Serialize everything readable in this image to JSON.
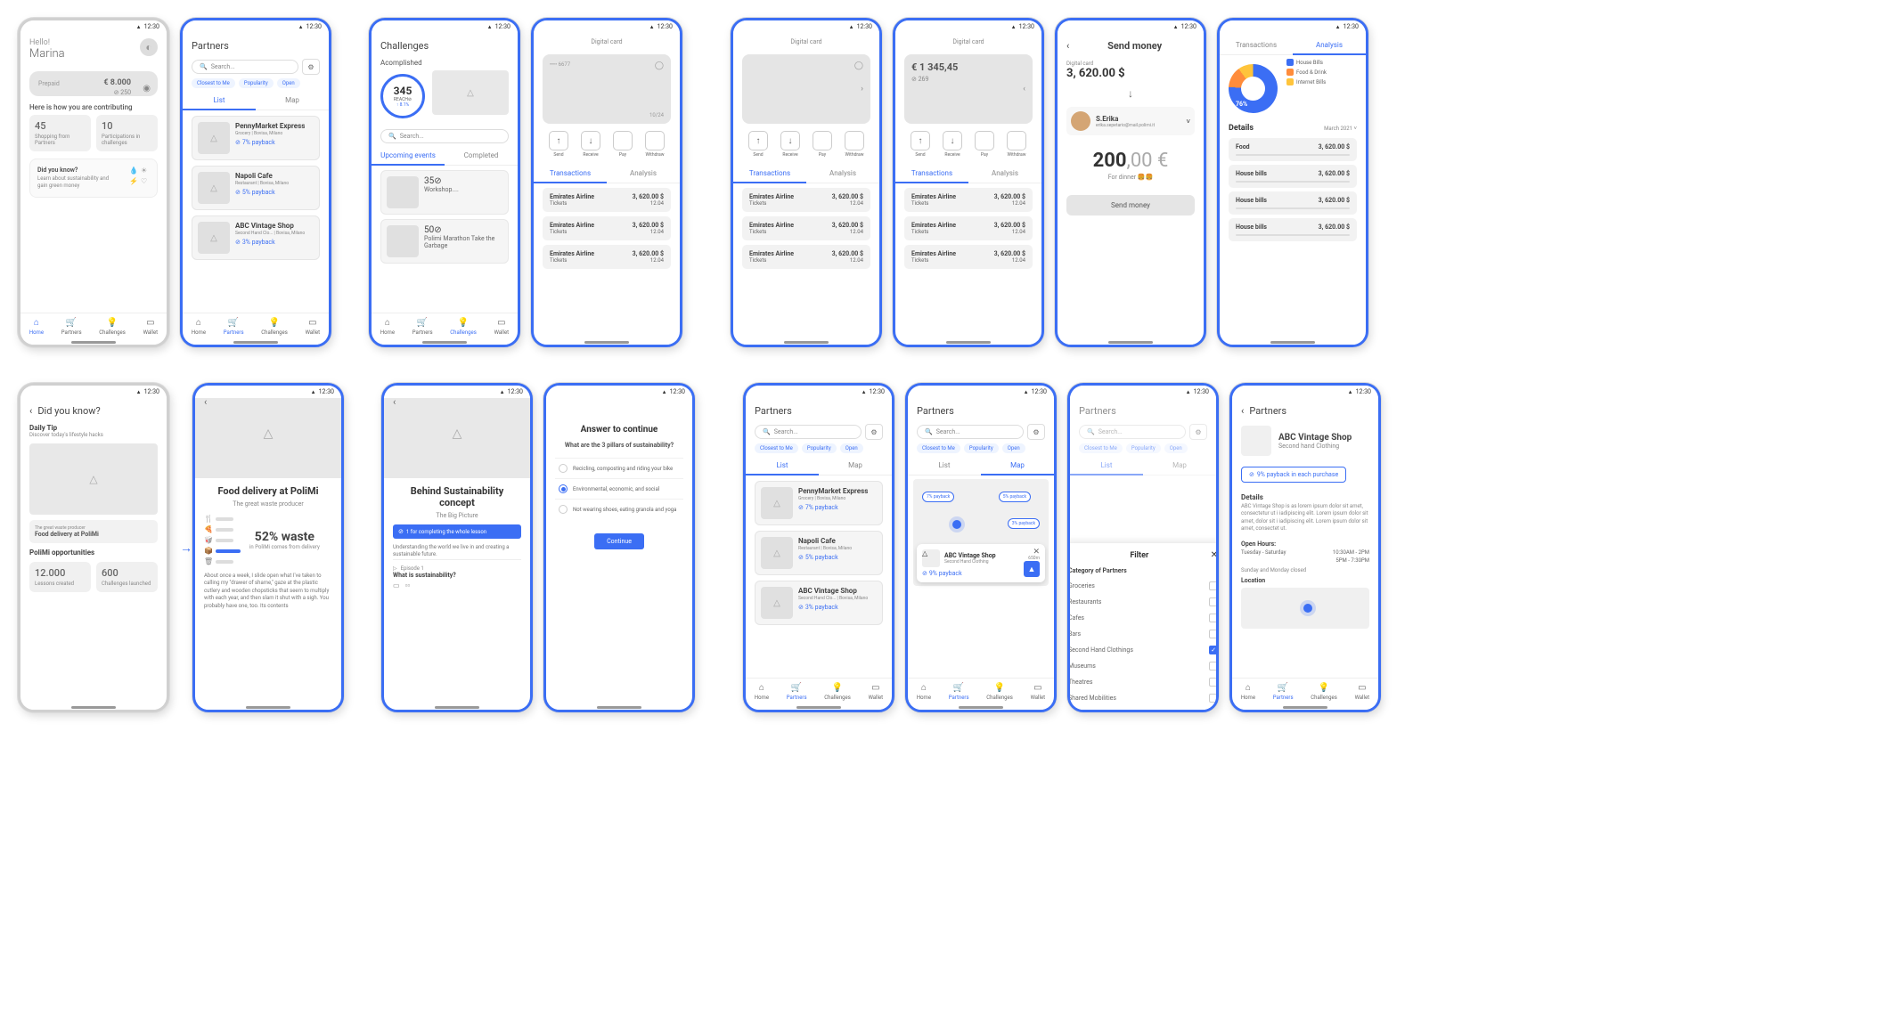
{
  "status_time": "12:30",
  "nav": {
    "home": "Home",
    "partners": "Partners",
    "challenges": "Challenges",
    "wallet": "Wallet"
  },
  "home": {
    "hello": "Hello!",
    "name": "Marina",
    "prepaid": "Prepaid",
    "balance": "€ 8.000",
    "points": "⊘ 250",
    "contribute_title": "Here is how you are contributing",
    "stats": [
      {
        "n": "45",
        "l": "Shopping from Partners"
      },
      {
        "n": "10",
        "l": "Participations in challenges"
      }
    ],
    "dyk_title": "Did you know?",
    "dyk_desc": "Learn about sustainability and gain green money"
  },
  "partners": {
    "title": "Partners",
    "search_ph": "Search...",
    "chips": [
      "Closest to Me",
      "Popularity",
      "Open"
    ],
    "tabs": {
      "list": "List",
      "map": "Map"
    },
    "items": [
      {
        "name": "PennyMarket Express",
        "meta": "Grocery  |  Bovisa, Milano",
        "pb": "7% payback"
      },
      {
        "name": "Napoli Cafe",
        "meta": "Restaurant  |  Bovisa, Milano",
        "pb": "5% payback"
      },
      {
        "name": "ABC Vintage Shop",
        "meta": "Second Hand Clo...  |  Bovisa, Milano",
        "pb": "3% payback"
      }
    ]
  },
  "challenges": {
    "title": "Challenges",
    "acc": "Acomplished",
    "reach": "345",
    "reach_l": "REACH⊘",
    "pct": "↑ 8.1%",
    "search_ph": "Search...",
    "tabs": {
      "up": "Upcoming events",
      "done": "Completed"
    },
    "events": [
      {
        "c": "35⊘",
        "t": "Workshop...."
      },
      {
        "c": "50⊘",
        "t": "Polimi Marathon Take the Garbage"
      }
    ]
  },
  "wallet": {
    "title": "Digital card",
    "card_dots": "•••• 6677",
    "exp": "10/24",
    "amt": "€ 1 345,45",
    "pts": "⊘ 269",
    "actions": [
      "Send",
      "Receive",
      "Pay",
      "Withdraw"
    ],
    "tabs": {
      "tx": "Transactions",
      "an": "Analysis"
    },
    "tx": [
      {
        "n": "Emirates Airline",
        "c": "Tickets",
        "a": "3, 620.00 $",
        "t": "12.04"
      },
      {
        "n": "Emirates Airline",
        "c": "Tickets",
        "a": "3, 620.00 $",
        "t": "12.04"
      },
      {
        "n": "Emirates Airline",
        "c": "Tickets",
        "a": "3, 620.00 $",
        "t": "12.04"
      }
    ]
  },
  "send": {
    "title": "Send money",
    "card_l": "Digital card",
    "card_amt": "3, 620.00 $",
    "pname": "S.Erika",
    "pemail": "erika.sepetario@mail.polimi.it",
    "amount": "200",
    ",cents": ",00 €",
    "note": "For dinner 🍔🍔",
    "btn": "Send money"
  },
  "analysis": {
    "tabs": {
      "tx": "Transactions",
      "an": "Analysis"
    },
    "pie_pct": "76%",
    "legend": [
      {
        "c": "#3b6ef4",
        "l": "House Bills"
      },
      {
        "c": "#ff8c3b",
        "l": "Food & Drink"
      },
      {
        "c": "#ffc43b",
        "l": "Internet Bills"
      }
    ],
    "details": "Details",
    "month": "March 2021 ˅",
    "rows": [
      {
        "l": "Food",
        "a": "3, 620.00 $"
      },
      {
        "l": "House bills",
        "a": "3, 620.00 $"
      },
      {
        "l": "House bills",
        "a": "3, 620.00 $"
      },
      {
        "l": "House bills",
        "a": "3, 620.00 $"
      }
    ]
  },
  "dyk": {
    "title": "Did you know?",
    "tip_t": "Daily Tip",
    "tip_d": "Discover today's lifestyle hacks",
    "card_sub": "The great waste producer",
    "card_t": "Food delivery at PoliMi",
    "opp_t": "PoliMi opportunities",
    "opp": [
      {
        "n": "12.000",
        "l": "Lessons created"
      },
      {
        "n": "600",
        "l": "Challenges launched"
      }
    ]
  },
  "article": {
    "title": "Food delivery at PoliMi",
    "sub": "The great waste producer",
    "waste": "52% waste",
    "waste_sub": "in PoliMi comes from delivery",
    "body": "About once a week, I slide open what I've taken to calling my \"drawer of shame,\" gaze at the plastic cutlery and wooden chopsticks that seem to multiply with each year, and then slam it shut with a sigh. You probably have one, too. Its contents"
  },
  "lesson": {
    "title": "Behind Sustainability concept",
    "sub": "The Big Picture",
    "badge": "1 for completing the whole lesson",
    "desc": "Understanding the world we live in and creating a sustainable future.",
    "ep_l": "Episode 1",
    "ep_t": "What is sustainability?"
  },
  "quiz": {
    "title": "Answer to continue",
    "q": "What are the 3 pillars of sustainability?",
    "opts": [
      "Recicling, composting and riding your bike",
      "Environmental, economic, and social",
      "Not wearing shoes, eating granola and yoga"
    ],
    "btn": "Continue"
  },
  "map": {
    "pins": [
      "7% payback",
      "5% payback",
      "3% payback"
    ],
    "popup": {
      "name": "ABC Vintage Shop",
      "cat": "Second Hand Clothing",
      "dist": "650m",
      "pb": "9% payback"
    }
  },
  "filter": {
    "title": "Filter",
    "cat_t": "Category of Partners",
    "opts": [
      "Groceries",
      "Restaurants",
      "Cafes",
      "Bars",
      "Second Hand Clothings",
      "Museums",
      "Theatres",
      "Shared Mobilities"
    ],
    "selected": 4
  },
  "shop": {
    "back": "Partners",
    "name": "ABC Vintage Shop",
    "cat": "Second hand Clothing",
    "pb": "9% payback in each purchase",
    "details": "Details",
    "desc": "ABC Vintage Shop is as lorem ipsum dolor sit amet, consectetur ut i iadipiscing elit. Lorem ipsum dolor sit amet, dolor sit i iadipiscing elit. Lorem ipsum dolor sit amet, consectet ut.",
    "hours_t": "Open Hours:",
    "hours": [
      {
        "d": "Tuesday - Saturday",
        "t": "10:30AM - 2PM"
      },
      {
        "d": "",
        "t": "5PM - 7:30PM"
      }
    ],
    "closed": "Sunday and Monday closed",
    "loc_t": "Location"
  }
}
